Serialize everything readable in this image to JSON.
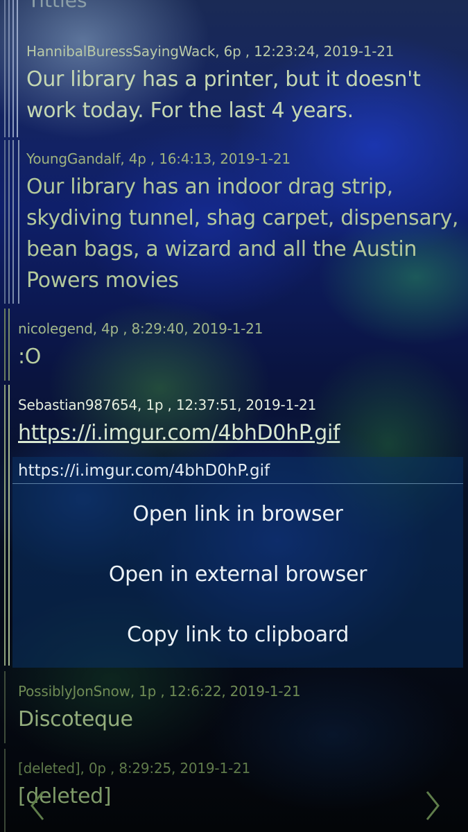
{
  "top_title": "Titties",
  "comments": [
    {
      "author": "HannibalBuressSayingWack, 6p , 12:23:24, 2019-1-21",
      "body": "Our library has a printer, but it doesn't work today. For the last 4 years."
    },
    {
      "author": "YoungGandalf, 4p , 16:4:13, 2019-1-21",
      "body": "Our library has an indoor drag strip, skydiving tunnel, shag carpet, dispensary, bean bags, a wizard and all the Austin Powers movies"
    },
    {
      "author": "nicolegend, 4p , 8:29:40, 2019-1-21",
      "body": ":O"
    },
    {
      "author": "Sebastian987654, 1p , 12:37:51, 2019-1-21",
      "body": "https://i.imgur.com/4bhD0hP.gif"
    },
    {
      "author": "PossiblyJonSnow, 1p , 12:6:22, 2019-1-21",
      "body": "Discoteque"
    },
    {
      "author": "[deleted], 0p , 8:29:25, 2019-1-21",
      "body": "[deleted]"
    }
  ],
  "context_menu": {
    "url": "https://i.imgur.com/4bhD0hP.gif",
    "items": [
      "Open link in browser",
      "Open in external browser",
      "Copy link to clipboard"
    ]
  },
  "nav": {
    "prev_icon": "chevron-left-icon",
    "next_icon": "chevron-right-icon"
  },
  "colors": {
    "author": "#8aa37a",
    "body": "#a9c596",
    "menu_text": "#ecf2f6",
    "menu_bg": "#0a3264"
  }
}
